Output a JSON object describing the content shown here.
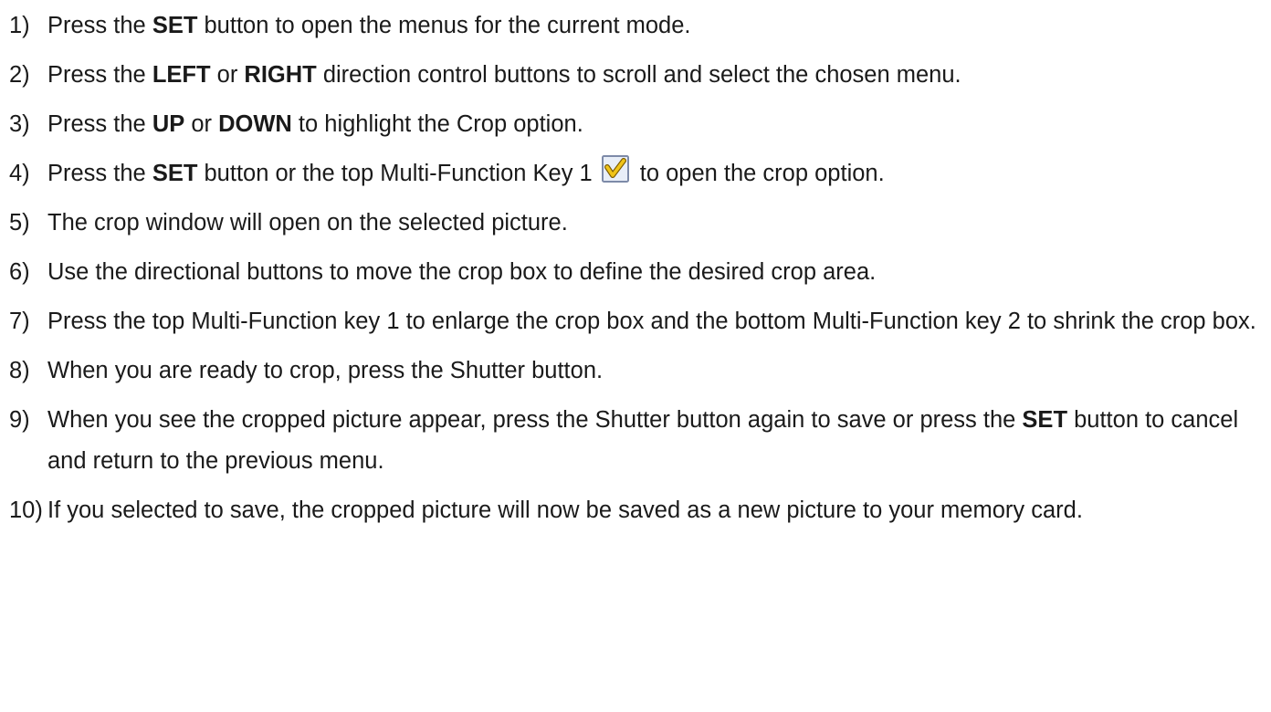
{
  "steps": [
    {
      "num": "1)",
      "parts": [
        {
          "t": "Press the "
        },
        {
          "t": "SET",
          "b": true
        },
        {
          "t": " button to open the menus for the current mode."
        }
      ]
    },
    {
      "num": "2)",
      "parts": [
        {
          "t": "Press the "
        },
        {
          "t": "LEFT",
          "b": true
        },
        {
          "t": " or "
        },
        {
          "t": "RIGHT",
          "b": true
        },
        {
          "t": " direction control buttons to scroll and select the chosen menu."
        }
      ]
    },
    {
      "num": "3)",
      "parts": [
        {
          "t": "Press the "
        },
        {
          "t": "UP",
          "b": true
        },
        {
          "t": " or "
        },
        {
          "t": "DOWN",
          "b": true
        },
        {
          "t": " to highlight the Crop option."
        }
      ]
    },
    {
      "num": "4)",
      "parts": [
        {
          "t": "Press the "
        },
        {
          "t": "SET",
          "b": true
        },
        {
          "t": " button or the top Multi-Function Key 1"
        },
        {
          "icon": "checkmark-key-icon"
        },
        {
          "t": "to open the crop option."
        }
      ]
    },
    {
      "num": "5)",
      "parts": [
        {
          "t": "The crop window will open on the selected picture."
        }
      ]
    },
    {
      "num": "6)",
      "parts": [
        {
          "t": "Use the directional buttons to move the crop box to define the desired crop area."
        }
      ]
    },
    {
      "num": "7)",
      "parts": [
        {
          "t": "Press the top Multi-Function key 1 to enlarge the crop box and the bottom Multi-Function key 2 to shrink the crop box."
        }
      ]
    },
    {
      "num": "8)",
      "parts": [
        {
          "t": "When you are ready to crop, press the Shutter button."
        }
      ]
    },
    {
      "num": "9)",
      "parts": [
        {
          "t": "When you see the cropped picture appear, press the Shutter button again to save or press the "
        },
        {
          "t": "SET",
          "b": true
        },
        {
          "t": " button to cancel and return to the previous menu."
        }
      ]
    },
    {
      "num": "10)",
      "parts": [
        {
          "t": "If you selected to save, the cropped picture will now be saved as a new picture to your memory card."
        }
      ]
    }
  ],
  "colors": {
    "text": "#1a1a1a",
    "icon_fill": "#e8eef8",
    "icon_border": "#7d8aa8",
    "check": "#f0c419",
    "check_outline": "#7a5a00"
  }
}
